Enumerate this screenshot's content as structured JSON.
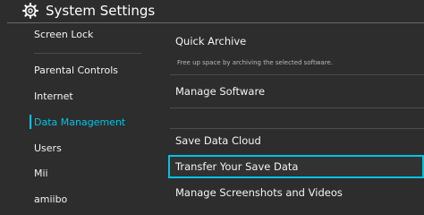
{
  "header": {
    "title": "System Settings",
    "icon": "gear-icon"
  },
  "sidebar": {
    "items": [
      {
        "label": "Screen Lock"
      },
      {
        "label": "Parental Controls"
      },
      {
        "label": "Internet"
      },
      {
        "label": "Data Management",
        "active": true
      },
      {
        "label": "Users"
      },
      {
        "label": "Mii"
      },
      {
        "label": "amiibo"
      }
    ]
  },
  "main": {
    "items": [
      {
        "label": "Quick Archive",
        "description": "Free up space by archiving the selected software."
      },
      {
        "label": "Manage Software"
      },
      {
        "label": "Save Data Cloud"
      },
      {
        "label": "Transfer Your Save Data",
        "selected": true
      },
      {
        "label": "Manage Screenshots and Videos"
      }
    ]
  },
  "colors": {
    "accent": "#00c3e3",
    "background": "#2d2d2d",
    "text": "#ffffff"
  }
}
